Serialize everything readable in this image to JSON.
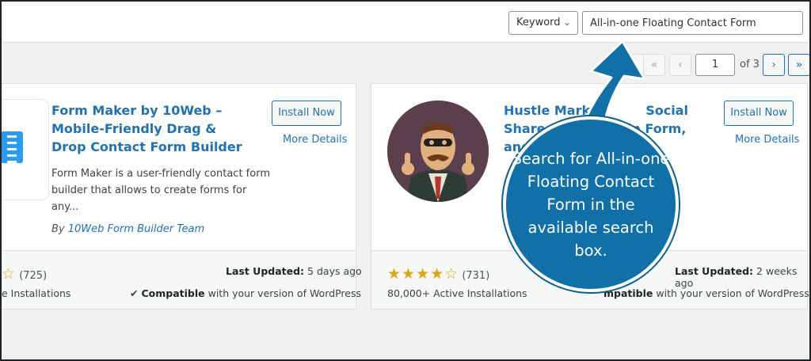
{
  "search": {
    "filter_label": "Keyword",
    "query": "All-in-one Floating Contact Form"
  },
  "pagination": {
    "first": "«",
    "prev": "‹",
    "current_page": "1",
    "of_label": "of 3",
    "next": "›",
    "last": "»"
  },
  "plugins": [
    {
      "title_lines": [
        "Form Maker by 10Web –",
        "Mobile-Friendly Drag &",
        "Drop Contact Form Builder"
      ],
      "install_label": "Install Now",
      "details_label": "More Details",
      "description_lines": [
        "Form Maker is a user-friendly contact form",
        "builder that allows to create forms for",
        "any..."
      ],
      "author_prefix": "By",
      "author_name": "10Web Form Builder Team",
      "rating_count": "(725)",
      "installs": "e Installations",
      "last_updated_label": "Last Updated:",
      "last_updated_value": "5 days ago",
      "compat_bold": "Compatible",
      "compat_rest": "with your version of WordPress"
    },
    {
      "title_lines": [
        "Hustle Market",
        "Share, Emai",
        "and P"
      ],
      "title_tail": [
        "Social",
        "in Form,",
        ""
      ],
      "install_label": "Install Now",
      "details_label": "More Details",
      "rating_stars": "★★★★☆",
      "rating_value": 4.5,
      "rating_count": "(731)",
      "installs": "80,000+ Active Installations",
      "last_updated_label": "Last Updated:",
      "last_updated_value": "2 weeks ago",
      "compat_bold": "mpatible",
      "compat_rest": "with your version of WordPress"
    }
  ],
  "callout": {
    "text": "Search for All-in-one Floating Contact Form in the available search box."
  },
  "colors": {
    "accent": "#2271b1",
    "callout": "#1170a8",
    "star": "#dba617"
  }
}
